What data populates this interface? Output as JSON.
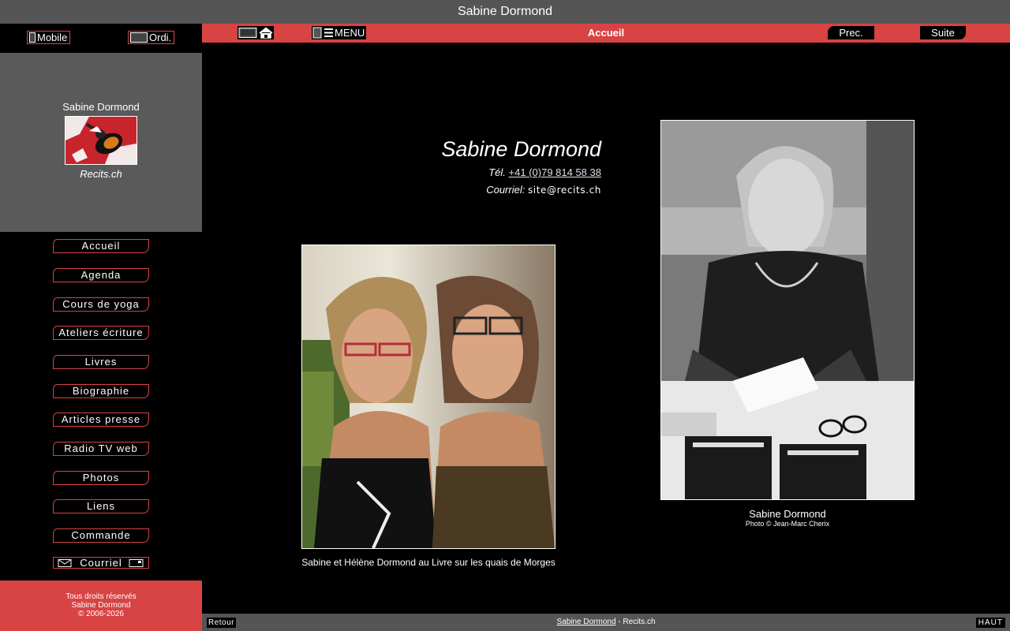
{
  "window": {
    "title": "Sabine Dormond"
  },
  "mode_switch": {
    "mobile_label": "Mobile",
    "desktop_label": "Ordi."
  },
  "profile": {
    "name": "Sabine Dormond",
    "site": "Recits.ch"
  },
  "topbar": {
    "title": "Accueil",
    "menu_label": "MENU",
    "prev_label": "Prec.",
    "next_label": "Suite"
  },
  "nav": {
    "items": [
      {
        "label": "Accueil"
      },
      {
        "label": "Agenda"
      },
      {
        "label": "Cours de yoga"
      },
      {
        "label": "Ateliers écriture"
      },
      {
        "label": "Livres"
      },
      {
        "label": "Biographie"
      },
      {
        "label": "Articles presse"
      },
      {
        "label": "Radio TV web"
      },
      {
        "label": "Photos"
      },
      {
        "label": "Liens"
      },
      {
        "label": "Commande"
      },
      {
        "label": "Courriel"
      }
    ]
  },
  "footer_left": {
    "line1": "Tous droits réservés",
    "line2": "Sabine Dormond",
    "line3": "© 2006-2026"
  },
  "contact": {
    "name": "Sabine Dormond",
    "tel_label": "Tél.",
    "tel_value": "+41 (0)79 814 58 38",
    "mail_label": "Courriel:",
    "mail_value": "site@recits.ch"
  },
  "photo1": {
    "caption": "Sabine et Hélène Dormond au Livre sur les quais de Morges"
  },
  "photo2": {
    "caption": "Sabine Dormond",
    "credit": "Photo © Jean-Marc Cherix"
  },
  "bottombar": {
    "back_label": "Retour",
    "link_text": "Sabine Dormond",
    "suffix": " - Recits.ch",
    "top_label": "HAUT"
  },
  "colors": {
    "accent_red": "#d84343",
    "panel_gray": "#5a5a5a",
    "bar_gray": "#555555"
  }
}
